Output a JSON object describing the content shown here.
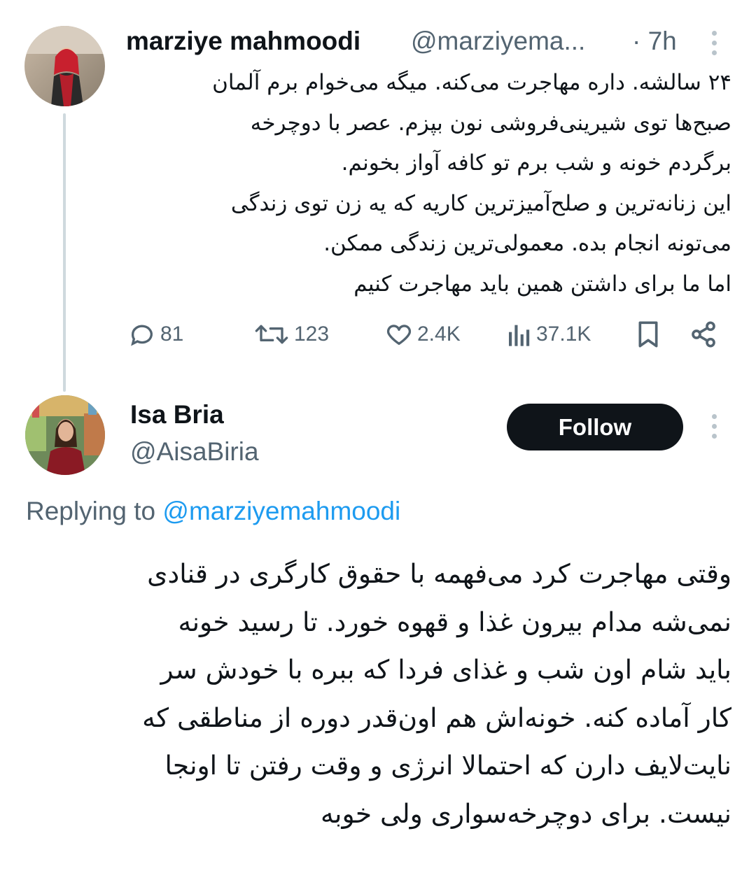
{
  "parent_tweet": {
    "author_name": "marziye mahmoodi",
    "author_handle": "@marziyema...",
    "time": "· 7h",
    "avatar_icon": "profile-photo-woman-red-scarf",
    "text_lines": [
      "۲۴ سالشه. داره مهاجرت می‌کنه. میگه می‌خوام برم آلمان",
      "صبح‌ها توی شیرینی‌فروشی نون بپزم. عصر با دوچرخه",
      "برگردم خونه و شب برم تو کافه آواز بخونم.",
      "این زنانه‌ترین و صلح‌آمیزترین کاریه که یه زن توی زندگی",
      "می‌تونه انجام بده. معمولی‌ترین زندگی ممکن.",
      "اما ما برای داشتن همین باید مهاجرت کنیم"
    ],
    "actions": {
      "replies": "81",
      "reposts": "123",
      "likes": "2.4K",
      "views": "37.1K"
    }
  },
  "reply_tweet": {
    "author_name": "Isa Bria",
    "author_handle": "@AisaBiria",
    "follow_label": "Follow",
    "avatar_icon": "profile-photo-woman-market",
    "replying_prefix": "Replying to ",
    "replying_to": "@marziyemahmoodi",
    "text_lines": [
      "وقتی مهاجرت کرد می‌فهمه با حقوق کارگری در قنادی",
      "نمی‌شه مدام بیرون غذا و قهوه خورد. تا رسید خونه",
      "باید شام اون شب و غذای فردا که ببره با خودش سر",
      "کار آماده کنه. خونه‌اش هم اون‌قدر دوره از مناطقی که",
      "نایت‌لایف دارن که احتمالا انرژی و وقت رفتن تا اونجا",
      "نیست. برای دوچرخه‌سواری ولی خوبه"
    ]
  },
  "colors": {
    "text": "#0f1419",
    "muted": "#536471",
    "link": "#1d9bf0",
    "thread_line": "#cfd9de",
    "follow_bg": "#0f1419",
    "follow_text": "#ffffff"
  }
}
